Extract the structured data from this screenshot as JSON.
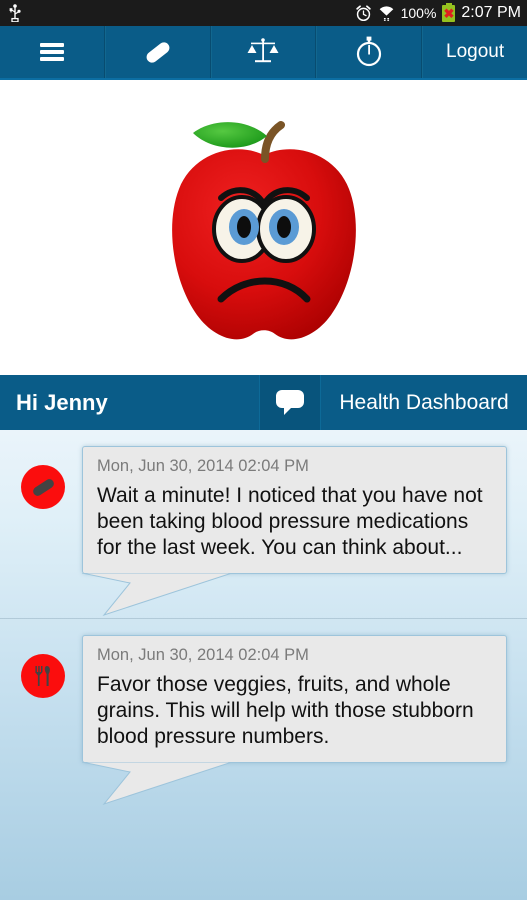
{
  "status_bar": {
    "usb_icon": "usb-icon",
    "alarm_icon": "alarm-clock-icon",
    "wifi_icon": "wifi-icon",
    "battery_percent": "100%",
    "battery_icon": "battery-error-icon",
    "time": "2:07 PM",
    "background": "#1b1b1b"
  },
  "toolbar": {
    "background": "#0a5c88",
    "items": [
      {
        "name": "menu",
        "icon": "hamburger-menu-icon",
        "label": ""
      },
      {
        "name": "medications",
        "icon": "pill-icon",
        "label": ""
      },
      {
        "name": "weight",
        "icon": "balance-scale-icon",
        "label": ""
      },
      {
        "name": "activity",
        "icon": "stopwatch-icon",
        "label": ""
      },
      {
        "name": "logout",
        "icon": "",
        "label": "Logout"
      }
    ]
  },
  "hero": {
    "image_name": "sad-apple-illustration",
    "apple_color": "#d40000",
    "leaf_color": "#2aa82a",
    "stem_color": "#7a5426",
    "eye_color": "#5b9bd5"
  },
  "greeting_bar": {
    "greeting": "Hi Jenny",
    "chat_icon": "chat-bubble-icon",
    "dashboard_label": "Health Dashboard",
    "background": "#0a5c88"
  },
  "messages": [
    {
      "avatar_icon": "pill-icon",
      "avatar_color": "#fb0d0d",
      "timestamp": "Mon, Jun 30, 2014 02:04 PM",
      "text": "Wait a minute! I noticed that you have not been taking blood pressure medications for the last week. You can think about..."
    },
    {
      "avatar_icon": "utensils-icon",
      "avatar_color": "#fb0d0d",
      "timestamp": "Mon, Jun 30, 2014 02:04 PM",
      "text": "Favor those veggies, fruits, and whole grains. This will help with those stubborn blood pressure numbers."
    }
  ]
}
